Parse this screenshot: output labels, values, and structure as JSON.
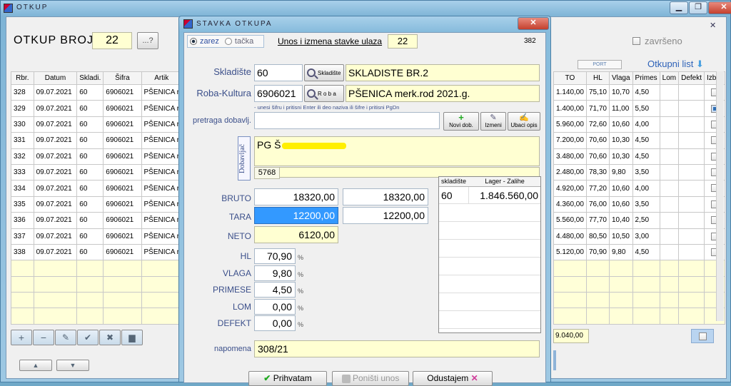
{
  "back": {
    "title": "OTKUP",
    "label": "OTKUP BROJ",
    "number": "22",
    "dots_btn": "...?",
    "zavrseno": "završeno",
    "port": "PORT",
    "otkupni_list": "Otkupni list",
    "cols_left": [
      "Rbr.",
      "Datum",
      "Skladi.",
      "Šifra",
      "Artik"
    ],
    "cols_right": [
      "TO",
      "HL",
      "Vlaga",
      "Primes",
      "Lom",
      "Defekt",
      "Izbor"
    ],
    "rows": [
      {
        "rbr": "328",
        "datum": "09.07.2021",
        "skl": "60",
        "sifra": "6906021",
        "art": "PŠENICA r",
        "to": "1.140,00",
        "hl": "75,10",
        "vlaga": "10,70",
        "primes": "4,50",
        "izbor": false
      },
      {
        "rbr": "329",
        "datum": "09.07.2021",
        "skl": "60",
        "sifra": "6906021",
        "art": "PŠENICA r",
        "to": "1.400,00",
        "hl": "71,70",
        "vlaga": "11,00",
        "primes": "5,50",
        "izbor": true
      },
      {
        "rbr": "330",
        "datum": "09.07.2021",
        "skl": "60",
        "sifra": "6906021",
        "art": "PŠENICA r",
        "to": "5.960,00",
        "hl": "72,60",
        "vlaga": "10,60",
        "primes": "4,00",
        "izbor": false
      },
      {
        "rbr": "331",
        "datum": "09.07.2021",
        "skl": "60",
        "sifra": "6906021",
        "art": "PŠENICA r",
        "to": "7.200,00",
        "hl": "70,60",
        "vlaga": "10,30",
        "primes": "4,50",
        "izbor": false
      },
      {
        "rbr": "332",
        "datum": "09.07.2021",
        "skl": "60",
        "sifra": "6906021",
        "art": "PŠENICA r",
        "to": "3.480,00",
        "hl": "70,60",
        "vlaga": "10,30",
        "primes": "4,50",
        "izbor": false
      },
      {
        "rbr": "333",
        "datum": "09.07.2021",
        "skl": "60",
        "sifra": "6906021",
        "art": "PŠENICA r",
        "to": "2.480,00",
        "hl": "78,30",
        "vlaga": "9,80",
        "primes": "3,50",
        "izbor": false
      },
      {
        "rbr": "334",
        "datum": "09.07.2021",
        "skl": "60",
        "sifra": "6906021",
        "art": "PŠENICA r",
        "to": "4.920,00",
        "hl": "77,20",
        "vlaga": "10,60",
        "primes": "4,00",
        "izbor": false
      },
      {
        "rbr": "335",
        "datum": "09.07.2021",
        "skl": "60",
        "sifra": "6906021",
        "art": "PŠENICA r",
        "to": "4.360,00",
        "hl": "76,00",
        "vlaga": "10,60",
        "primes": "3,50",
        "izbor": false
      },
      {
        "rbr": "336",
        "datum": "09.07.2021",
        "skl": "60",
        "sifra": "6906021",
        "art": "PŠENICA r",
        "to": "5.560,00",
        "hl": "77,70",
        "vlaga": "10,40",
        "primes": "2,50",
        "izbor": false
      },
      {
        "rbr": "337",
        "datum": "09.07.2021",
        "skl": "60",
        "sifra": "6906021",
        "art": "PŠENICA r",
        "to": "4.480,00",
        "hl": "80,50",
        "vlaga": "10,50",
        "primes": "3,00",
        "izbor": false
      },
      {
        "rbr": "338",
        "datum": "09.07.2021",
        "skl": "60",
        "sifra": "6906021",
        "art": "PŠENICA r",
        "to": "5.120,00",
        "hl": "70,90",
        "vlaga": "9,80",
        "primes": "4,50",
        "izbor": false
      }
    ],
    "total": "9.040,00"
  },
  "dlg": {
    "title": "STAVKA OTKUPA",
    "radio_zarez": "zarez",
    "radio_tacka": "tačka",
    "unos_label": "Unos i izmena stavke ulaza",
    "unos_num": "22",
    "num382": "382",
    "skladiste_label": "Skladište",
    "skladiste_val": "60",
    "skladiste_btn": "Skladište",
    "skladiste_name": "SKLADISTE BR.2",
    "roba_label": "Roba-Kultura",
    "roba_val": "6906021",
    "roba_btn": "R o b a",
    "roba_name": "PŠENICA merk.rod 2021.g.",
    "hint": "- unesi šifru i pritisni Enter ili deo naziva ili šifre i pritisni PgDn",
    "pretraga_label": "pretraga dobavlj.",
    "novi_dob": "Novi dob.",
    "izmeni": "Izmeni",
    "ubaci_opis": "Ubaci opis",
    "dobavljac_tab": "Dobavljač",
    "dobavljac_name": "PG Š",
    "dobavljac_id": "5768",
    "bruto_label": "BRUTO",
    "bruto": "18320,00",
    "bruto2": "18320,00",
    "tara_label": "TARA",
    "tara": "12200,00",
    "tara2": "12200,00",
    "neto_label": "NETO",
    "neto": "6120,00",
    "hl_label": "HL",
    "hl": "70,90",
    "vlaga_label": "VLAGA",
    "vlaga": "9,80",
    "primese_label": "PRIMESE",
    "primese": "4,50",
    "lom_label": "LOM",
    "lom": "0,00",
    "defekt_label": "DEFEKT",
    "defekt": "0,00",
    "pct": "%",
    "stock_cols": [
      "skladište",
      "Lager - Zalihe"
    ],
    "stock_skl": "60",
    "stock_val": "1.846.560,00",
    "napomena_label": "napomena",
    "napomena": "308/21",
    "btn_ok": "Prihvatam",
    "btn_undo": "Poništi unos",
    "btn_cancel": "Odustajem"
  }
}
